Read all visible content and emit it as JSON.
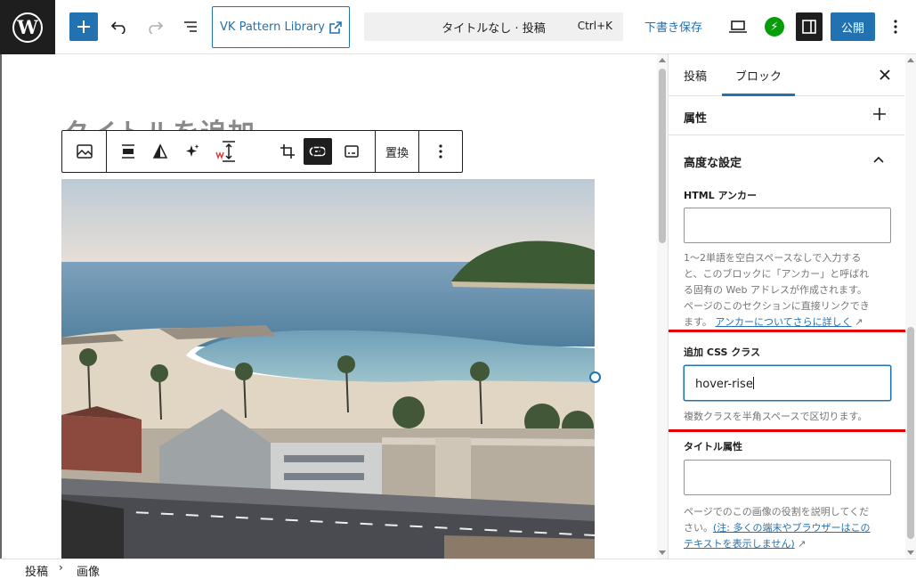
{
  "topbar": {
    "vk_button_label": "VK Pattern Library",
    "command_title": "タイトルなし · 投稿",
    "command_shortcut": "Ctrl+K",
    "save_draft_label": "下書き保存",
    "publish_label": "公開"
  },
  "editor": {
    "title_placeholder": "タイトルを追加",
    "toolbar": {
      "replace_label": "置換"
    }
  },
  "sidebar": {
    "tabs": [
      {
        "label": "投稿"
      },
      {
        "label": "ブロック"
      }
    ],
    "panels": {
      "attributes_label": "属性",
      "advanced_label": "高度な設定"
    },
    "html_anchor": {
      "label": "HTML アンカー",
      "value": "",
      "help_lines": [
        "1〜2単語を空白スペースなしで入力する",
        "と、このブロックに「アンカー」と呼ばれ",
        "る固有の Web アドレスが作成されます。",
        "ページのこのセクションに直接リンクでき",
        "ます。"
      ],
      "help_link": "アンカーについてさらに詳しく"
    },
    "css_class": {
      "label": "追加 CSS クラス",
      "value": "hover-rise",
      "help": "複数クラスを半角スペースで区切ります。"
    },
    "title_attr": {
      "label": "タイトル属性",
      "value": "",
      "help_line1": "ページでのこの画像の役割を説明してくだ",
      "help_line2_prefix": "さい。",
      "help_link_1": "(注: 多くの端末やブラウザーはこの",
      "help_link_2": "テキストを表示しません)"
    }
  },
  "breadcrumb": {
    "items": [
      "投稿",
      "画像"
    ]
  },
  "colors": {
    "accent": "#2271b1",
    "dark": "#1e1e1e",
    "highlight": "#e60000",
    "jetpack": "#069e08"
  },
  "icons": {
    "topbar": [
      "wordpress-logo-icon",
      "plus-icon",
      "undo-icon",
      "redo-icon",
      "list-view-icon",
      "external-link-icon",
      "desktop-preview-icon",
      "jetpack-icon",
      "settings-sidebar-icon",
      "more-options-icon"
    ],
    "block_toolbar": [
      "image-icon",
      "align-wide-icon",
      "duotone-icon",
      "ai-sparkle-icon",
      "height-adjust-icon",
      "link-icon",
      "crop-icon",
      "text-overlay-icon",
      "caption-icon",
      "more-options-icon"
    ]
  }
}
